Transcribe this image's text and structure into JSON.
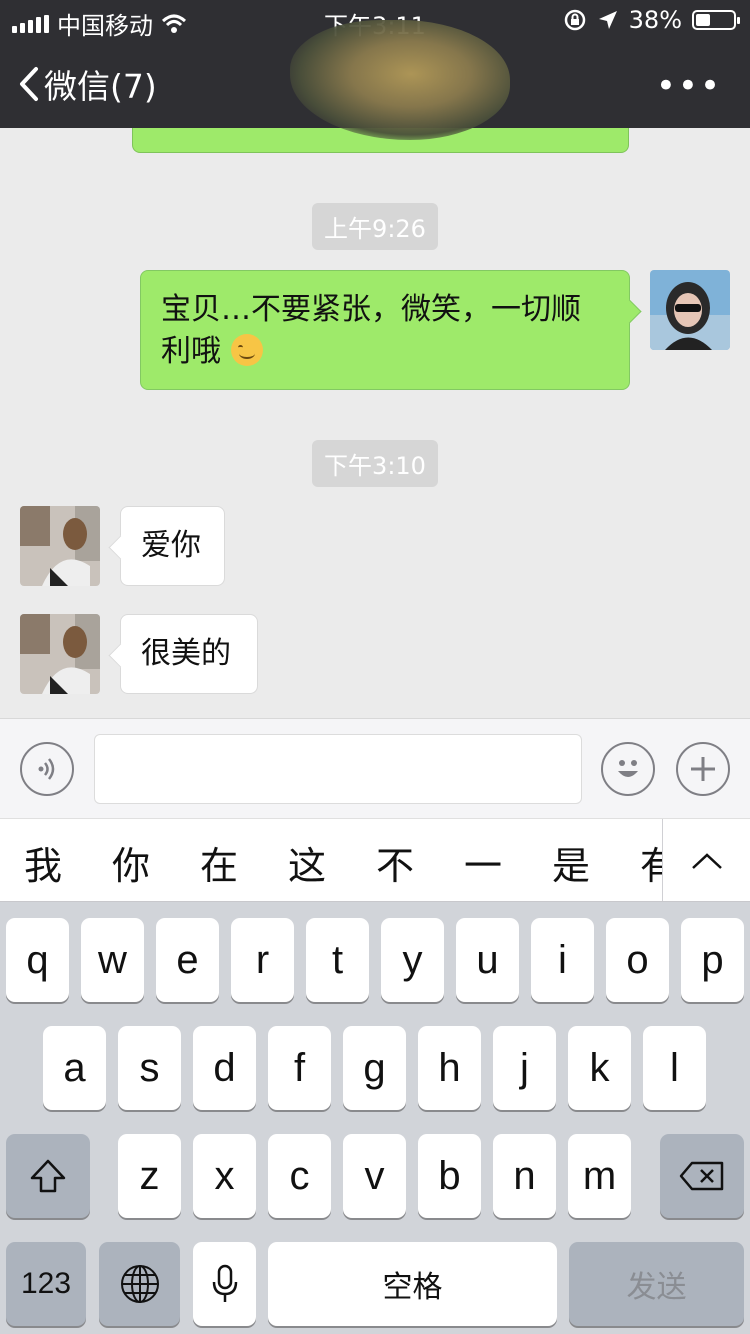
{
  "status_bar": {
    "carrier": "中国移动",
    "time": "下午3:11",
    "battery_percent": "38%",
    "battery_level": 0.38
  },
  "nav": {
    "back_label": "微信(7)",
    "more_label": "•••"
  },
  "messages": {
    "ts1": "上午9:26",
    "m1": "宝贝…不要紧张，微笑，一切顺",
    "m1b": "利哦",
    "ts2": "下午3:10",
    "m2": "爱你",
    "m3": "很美的"
  },
  "candidates": [
    "我",
    "你",
    "在",
    "这",
    "不",
    "一",
    "是",
    "有"
  ],
  "keyboard": {
    "row1": [
      "q",
      "w",
      "e",
      "r",
      "t",
      "y",
      "u",
      "i",
      "o",
      "p"
    ],
    "row2": [
      "a",
      "s",
      "d",
      "f",
      "g",
      "h",
      "j",
      "k",
      "l"
    ],
    "row3": [
      "z",
      "x",
      "c",
      "v",
      "b",
      "n",
      "m"
    ],
    "numbers": "123",
    "space": "空格",
    "send": "发送"
  },
  "colors": {
    "header": "#2f2f33",
    "my_bubble": "#9eea6a",
    "their_bubble": "#ffffff",
    "chat_bg": "#ebebeb",
    "keyboard_bg": "#d1d4d9"
  },
  "icons": [
    "signal-icon",
    "wifi-icon",
    "rotation-lock-icon",
    "location-icon",
    "battery-icon",
    "back-chevron-icon",
    "more-icon",
    "voice-icon",
    "emoji-icon",
    "plus-icon",
    "collapse-chevron-icon",
    "shift-icon",
    "backspace-icon",
    "globe-icon",
    "microphone-icon"
  ]
}
